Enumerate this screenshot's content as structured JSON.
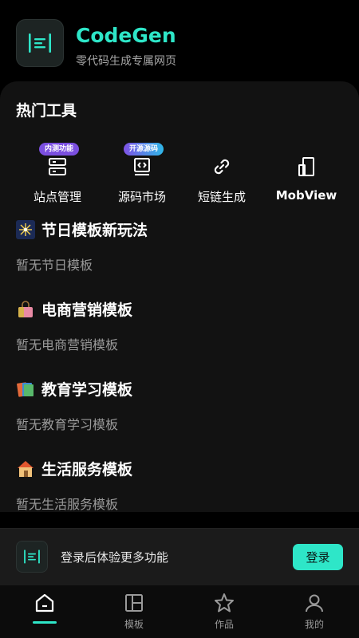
{
  "header": {
    "title": "CodeGen",
    "subtitle": "零代码生成专属网页",
    "logo_icon": "document-lines-icon"
  },
  "hot_tools": {
    "title": "热门工具",
    "items": [
      {
        "label": "站点管理",
        "icon": "server-icon",
        "badge": "内测功能"
      },
      {
        "label": "源码市场",
        "icon": "code-window-icon",
        "badge": "开源源码"
      },
      {
        "label": "短链生成",
        "icon": "link-icon",
        "badge": ""
      },
      {
        "label": "MobView",
        "icon": "mobile-view-icon",
        "badge": ""
      }
    ]
  },
  "categories": [
    {
      "title": "节日模板新玩法",
      "empty": "暂无节日模板",
      "icon": "fireworks-icon"
    },
    {
      "title": "电商营销模板",
      "empty": "暂无电商营销模板",
      "icon": "shopping-bag-icon"
    },
    {
      "title": "教育学习模板",
      "empty": "暂无教育学习模板",
      "icon": "books-icon"
    },
    {
      "title": "生活服务模板",
      "empty": "暂无生活服务模板",
      "icon": "house-icon"
    }
  ],
  "login_bar": {
    "text": "登录后体验更多功能",
    "button": "登录"
  },
  "bottom_nav": {
    "items": [
      {
        "label": "",
        "icon": "home-icon",
        "active": true
      },
      {
        "label": "模板",
        "icon": "template-icon",
        "active": false
      },
      {
        "label": "作品",
        "icon": "star-icon",
        "active": false
      },
      {
        "label": "我的",
        "icon": "user-icon",
        "active": false
      }
    ]
  },
  "colors": {
    "accent": "#2ee6c8",
    "background": "#000000",
    "card": "#121212",
    "badge_purple": "#7b4fe0"
  }
}
